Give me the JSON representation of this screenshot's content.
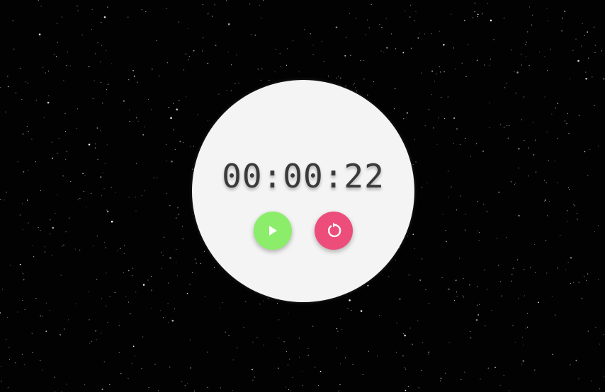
{
  "timer": {
    "display": "00:00:22"
  },
  "controls": {
    "play": {
      "icon": "play-icon",
      "color": "#8ced6a"
    },
    "reset": {
      "icon": "reset-icon",
      "color": "#ec4d7a"
    }
  },
  "colors": {
    "background": "#020202",
    "card": "#f4f4f4",
    "text": "#3a3a3a"
  }
}
